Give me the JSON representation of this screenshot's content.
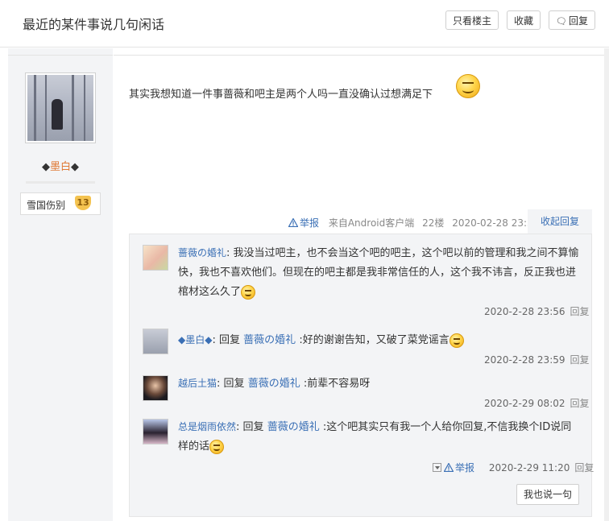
{
  "header": {
    "title": "最近的某件事说几句闲话",
    "only_op_label": "只看楼主",
    "favorite_label": "收藏",
    "reply_label": "回复",
    "reply_icon": "comment-icon"
  },
  "author": {
    "username_prefix": "◆",
    "username": "墨白",
    "username_suffix": "◆",
    "badge_name": "雪国伤别",
    "badge_level": "13"
  },
  "post": {
    "text": "其实我想知道一件事蔷薇和吧主是两个人吗一直没确认过想满足下",
    "report_label": "举报",
    "source": "来自Android客户端",
    "floor": "22楼",
    "time": "2020-02-28 23:53",
    "collapse_label": "收起回复"
  },
  "comments": [
    {
      "user": "蔷薇の婚礼",
      "separator": ":",
      "text": "我没当过吧主，也不会当这个吧的吧主，这个吧以前的管理和我之间不算愉快，我也不喜欢他们。但现在的吧主都是我非常信任的人，这个我不讳言，反正我也进棺材这么久了",
      "time": "2020-2-28 23:56",
      "reply_label": "回复"
    },
    {
      "user": "◆墨白◆",
      "separator": ":",
      "reply_prefix": "回复",
      "reply_to": "蔷薇の婚礼",
      "text": ":好的谢谢告知，又破了菜党谣言",
      "time": "2020-2-28 23:59",
      "reply_label": "回复"
    },
    {
      "user": "越后土猫",
      "separator": ":",
      "reply_prefix": "回复",
      "reply_to": "蔷薇の婚礼",
      "text": ":前辈不容易呀",
      "time": "2020-2-29 08:02",
      "reply_label": "回复"
    },
    {
      "user": "总是烟雨依然",
      "separator": ":",
      "reply_prefix": "回复",
      "reply_to": "蔷薇の婚礼",
      "text": ":这个吧其实只有我一个人给你回复,不信我换个ID说同样的话",
      "report_label": "举报",
      "time": "2020-2-29 11:20",
      "reply_label": "回复"
    }
  ],
  "say_button_label": "我也说一句"
}
